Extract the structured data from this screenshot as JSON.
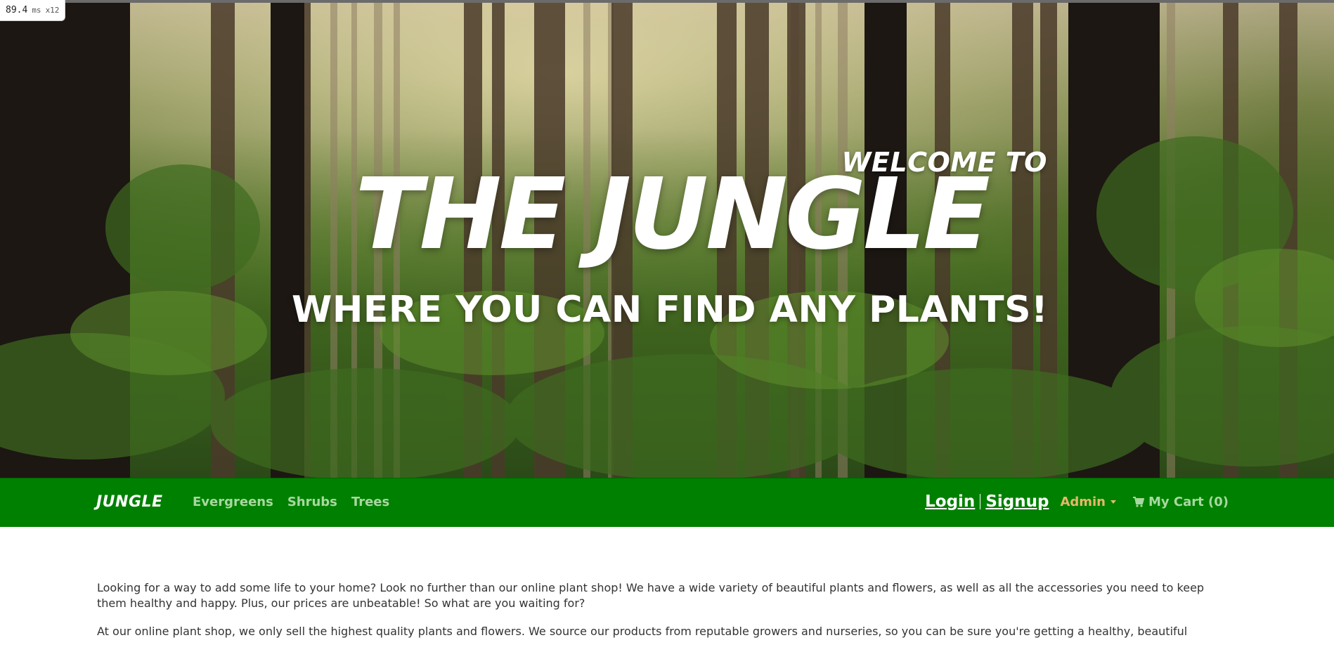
{
  "perf_badge": {
    "value": "89.4",
    "unit": "ms",
    "multiplier": "x12"
  },
  "hero": {
    "welcome": "WELCOME TO",
    "title": "THE JUNGLE",
    "tagline": "WHERE YOU CAN FIND ANY PLANTS!"
  },
  "navbar": {
    "brand": "JUNGLE",
    "links": [
      "Evergreens",
      "Shrubs",
      "Trees"
    ],
    "login": "Login",
    "signup": "Signup",
    "admin": "Admin",
    "cart": "My Cart (0)"
  },
  "content": {
    "paragraphs": [
      "Looking for a way to add some life to your home? Look no further than our online plant shop! We have a wide variety of beautiful plants and flowers, as well as all the accessories you need to keep them healthy and happy. Plus, our prices are unbeatable! So what are you waiting for?",
      "At our online plant shop, we only sell the highest quality plants and flowers. We source our products from reputable growers and nurseries, so you can be sure you're getting a healthy, beautiful"
    ]
  },
  "colors": {
    "navbar_bg": "#008000",
    "nav_link": "#a8d8a0",
    "admin": "#e7b86b",
    "brand": "#ffffff"
  }
}
